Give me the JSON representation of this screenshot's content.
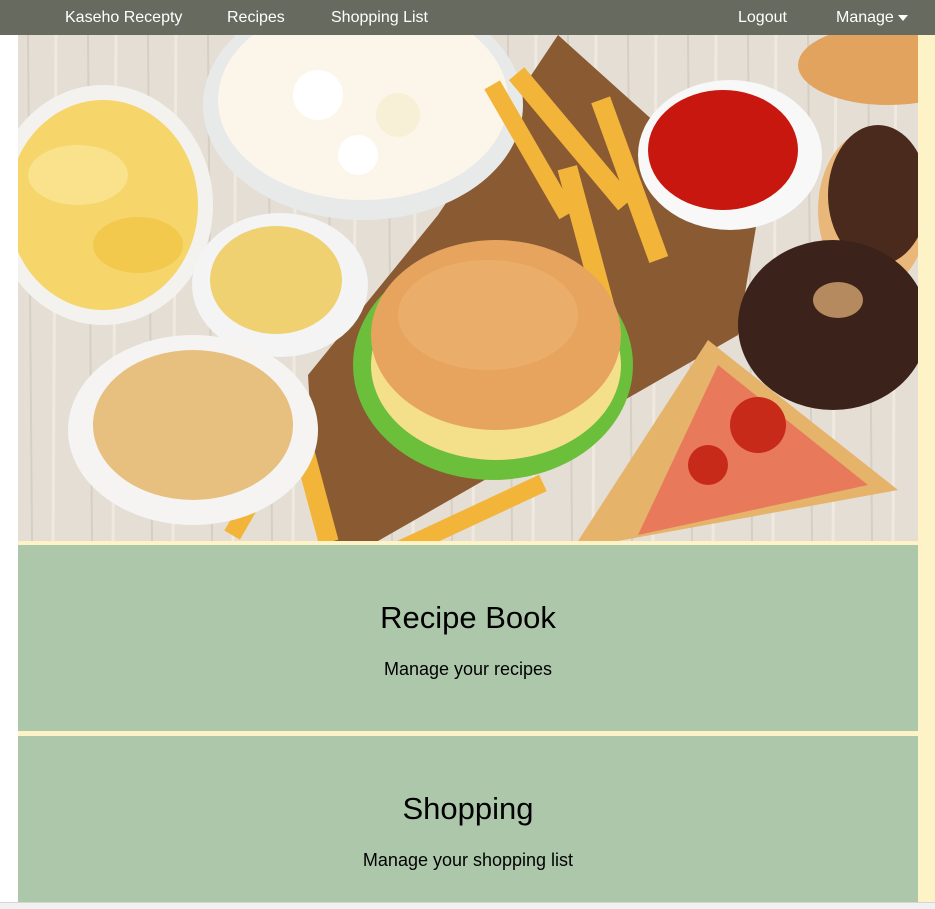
{
  "nav": {
    "brand": "Kaseho Recepty",
    "recipes": "Recipes",
    "shopping_list": "Shopping List",
    "logout": "Logout",
    "manage": "Manage"
  },
  "cards": [
    {
      "title": "Recipe Book",
      "subtitle": "Manage your recipes"
    },
    {
      "title": "Shopping",
      "subtitle": "Manage your shopping list"
    }
  ],
  "colors": {
    "navbar": "#676a5e",
    "card": "#adc7ab",
    "background": "#fdf3c6"
  }
}
